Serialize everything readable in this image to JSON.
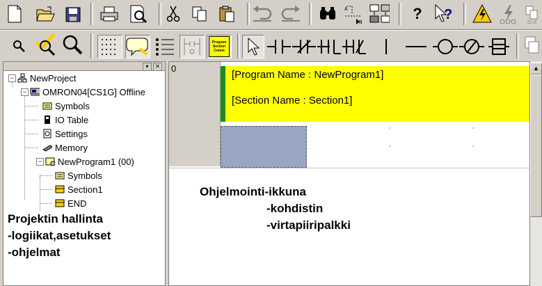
{
  "toolbar1": {
    "icons": [
      "new-file-icon",
      "open-folder-icon",
      "save-icon",
      "print-icon",
      "print-preview-icon",
      "cut-icon",
      "copy-icon",
      "paste-icon",
      "undo-icon",
      "redo-icon",
      "find-icon",
      "jump-icon",
      "replace-icon",
      "help-icon",
      "context-help-icon",
      "online-icon",
      "transfer-icon",
      "compare-icon"
    ],
    "glyphs": {
      "help": "?",
      "context_help": "?"
    }
  },
  "toolbar2": {
    "section_tag": [
      "Program",
      "Section",
      "Comm"
    ]
  },
  "project_tree": {
    "root": "NewProject",
    "plc": "OMRON04[CS1G] Offline",
    "plc_children": [
      "Symbols",
      "IO Table",
      "Settings",
      "Memory"
    ],
    "program": "NewProgram1 (00)",
    "program_children": [
      "Symbols",
      "Section1",
      "END"
    ]
  },
  "project_caption": [
    "Projektin hallinta",
    "-logiikat,asetukset",
    "-ohjelmat"
  ],
  "editor": {
    "rung_number": "0",
    "program_name": "[Program Name : NewProgram1]",
    "section_name": "[Section Name : Section1]",
    "caption": [
      "Ohjelmointi-ikkuna",
      "-kohdistin",
      "-virtapiiripalkki"
    ]
  },
  "colors": {
    "header_bg": "#ffff00",
    "power_rail": "#1e8c1e",
    "cursor": "#98a6c2"
  }
}
